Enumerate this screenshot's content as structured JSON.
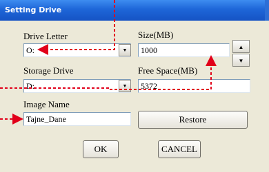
{
  "window": {
    "title": "Setting Drive"
  },
  "labels": {
    "drive_letter": "Drive Letter",
    "size": "Size(MB)",
    "storage_drive": "Storage Drive",
    "free_space": "Free Space(MB)",
    "image_name": "Image Name"
  },
  "fields": {
    "drive_letter_value": "O:",
    "size_value": "1000",
    "storage_drive_value": "D:",
    "free_space_value": "5372",
    "image_name_value": "Tajne_Dane"
  },
  "buttons": {
    "restore": "Restore",
    "ok": "OK",
    "cancel": "CANCEL"
  },
  "icons": {
    "dropdown": "chevron-down-icon",
    "spin_up": "arrow-up-icon",
    "spin_down": "arrow-down-icon"
  },
  "colors": {
    "annotation": "#e1001a",
    "titlebar": "#1e66d8"
  }
}
